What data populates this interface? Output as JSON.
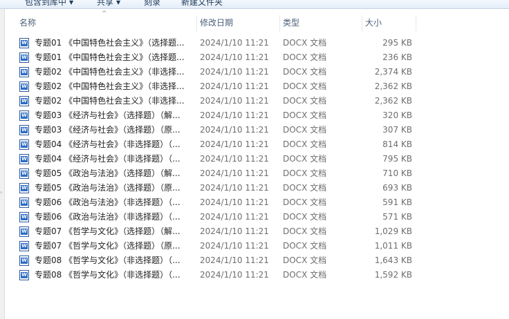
{
  "toolbar": {
    "include_library": "包含到库中",
    "share": "共享",
    "burn": "刻录",
    "new_folder": "新建文件夹"
  },
  "columns": {
    "name": "名称",
    "date": "修改日期",
    "type": "类型",
    "size": "大小"
  },
  "files": [
    {
      "name": "专题01 《中国特色社会主义》（选择题...",
      "date": "2024/1/10 11:21",
      "type": "DOCX 文档",
      "size": "295 KB"
    },
    {
      "name": "专题01 《中国特色社会主义》（选择题...",
      "date": "2024/1/10 11:21",
      "type": "DOCX 文档",
      "size": "236 KB"
    },
    {
      "name": "专题02 《中国特色社会主义》（非选择...",
      "date": "2024/1/10 11:21",
      "type": "DOCX 文档",
      "size": "2,374 KB"
    },
    {
      "name": "专题02 《中国特色社会主义》（非选择...",
      "date": "2024/1/10 11:21",
      "type": "DOCX 文档",
      "size": "2,362 KB"
    },
    {
      "name": "专题02 《中国特色社会主义》（非选择...",
      "date": "2024/1/10 11:21",
      "type": "DOCX 文档",
      "size": "2,362 KB"
    },
    {
      "name": "专题03 《经济与社会》（选择题）（解...",
      "date": "2024/1/10 11:21",
      "type": "DOCX 文档",
      "size": "320 KB"
    },
    {
      "name": "专题03 《经济与社会》（选择题）（原...",
      "date": "2024/1/10 11:21",
      "type": "DOCX 文档",
      "size": "307 KB"
    },
    {
      "name": "专题04 《经济与社会》（非选择题）（...",
      "date": "2024/1/10 11:21",
      "type": "DOCX 文档",
      "size": "814 KB"
    },
    {
      "name": "专题04 《经济与社会》（非选择题）（...",
      "date": "2024/1/10 11:21",
      "type": "DOCX 文档",
      "size": "795 KB"
    },
    {
      "name": "专题05 《政治与法治》（选择题）（解...",
      "date": "2024/1/10 11:21",
      "type": "DOCX 文档",
      "size": "710 KB"
    },
    {
      "name": "专题05 《政治与法治》（选择题）（原...",
      "date": "2024/1/10 11:21",
      "type": "DOCX 文档",
      "size": "693 KB"
    },
    {
      "name": "专题06 《政治与法治》（非选择题）（...",
      "date": "2024/1/10 11:21",
      "type": "DOCX 文档",
      "size": "591 KB"
    },
    {
      "name": "专题06 《政治与法治》（非选择题）（...",
      "date": "2024/1/10 11:21",
      "type": "DOCX 文档",
      "size": "571 KB"
    },
    {
      "name": "专题07 《哲学与文化》（选择题）（解...",
      "date": "2024/1/10 11:21",
      "type": "DOCX 文档",
      "size": "1,029 KB"
    },
    {
      "name": "专题07 《哲学与文化》（选择题）（原...",
      "date": "2024/1/10 11:21",
      "type": "DOCX 文档",
      "size": "1,011 KB"
    },
    {
      "name": "专题08 《哲学与文化》（非选择题）（...",
      "date": "2024/1/10 11:21",
      "type": "DOCX 文档",
      "size": "1,643 KB"
    },
    {
      "name": "专题08 《哲学与文化》（非选择题）（...",
      "date": "2024/1/10 11:21",
      "type": "DOCX 文档",
      "size": "1,592 KB"
    }
  ],
  "icons": {
    "toolbar_dropdown": "chevron-down-icon",
    "sort": "sort-ascending-icon",
    "file": "word-document-icon"
  }
}
